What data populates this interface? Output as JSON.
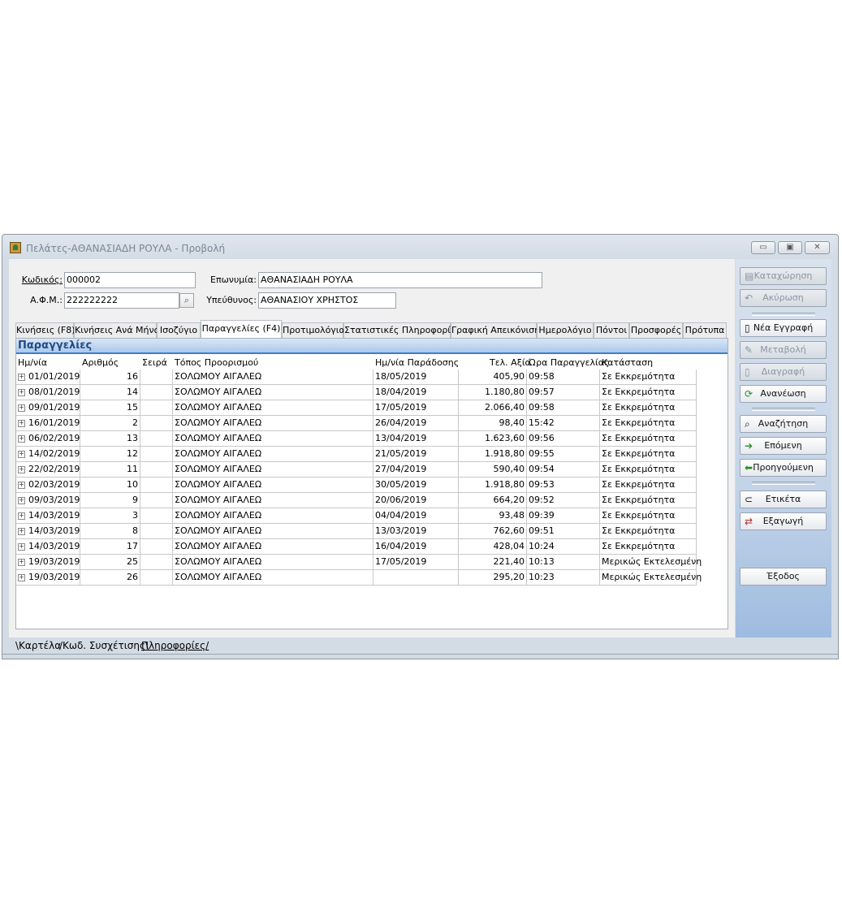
{
  "window": {
    "title": "Πελάτες-ΑΘΑΝΑΣΙΑΔΗ ΡΟΥΛΑ -  Προβολή",
    "controls": {
      "minimize": "▭",
      "maximize": "▣",
      "close": "✕"
    }
  },
  "form": {
    "code_label": "Κωδικός:",
    "code_value": "000002",
    "surname_label": "Επωνυμία:",
    "surname_value": "ΑΘΑΝΑΣΙΑΔΗ ΡΟΥΛΑ",
    "afm_label": "Α.Φ.Μ.:",
    "afm_value": "222222222",
    "responsible_label": "Υπεύθυνος:",
    "responsible_value": "ΑΘΑΝΑΣΙΟΥ ΧΡΗΣΤΟΣ"
  },
  "tabs": [
    "Κινήσεις (F8)",
    "Κινήσεις Ανά Μήνα",
    "Ισοζύγιο",
    "Παραγγελίες (F4)",
    "Προτιμολόγια",
    "Στατιστικές Πληροφορίες",
    "Γραφική Απεικόνιση",
    "Ημερολόγιο",
    "Πόντοι",
    "Προσφορές",
    "Πρότυπα"
  ],
  "active_tab": "Παραγγελίες (F4)",
  "panel": {
    "title": "Παραγγελίες",
    "columns": [
      "Ημ/νία",
      "Αριθμός",
      "Σειρά",
      "Τόπος Προορισμού",
      "Ημ/νία Παράδοσης",
      "Τελ. Αξία",
      "Ώρα Παραγγελίας",
      "Κατάσταση"
    ],
    "rows": [
      [
        "01/01/2019",
        "16",
        "",
        "ΣΟΛΩΜΟΥ ΑΙΓΑΛΕΩ",
        "18/05/2019",
        "405,90",
        "09:58",
        "Σε Εκκρεμότητα"
      ],
      [
        "08/01/2019",
        "14",
        "",
        "ΣΟΛΩΜΟΥ ΑΙΓΑΛΕΩ",
        "18/04/2019",
        "1.180,80",
        "09:57",
        "Σε Εκκρεμότητα"
      ],
      [
        "09/01/2019",
        "15",
        "",
        "ΣΟΛΩΜΟΥ ΑΙΓΑΛΕΩ",
        "17/05/2019",
        "2.066,40",
        "09:58",
        "Σε Εκκρεμότητα"
      ],
      [
        "16/01/2019",
        "2",
        "",
        "ΣΟΛΩΜΟΥ ΑΙΓΑΛΕΩ",
        "26/04/2019",
        "98,40",
        "15:42",
        "Σε Εκκρεμότητα"
      ],
      [
        "06/02/2019",
        "13",
        "",
        "ΣΟΛΩΜΟΥ ΑΙΓΑΛΕΩ",
        "13/04/2019",
        "1.623,60",
        "09:56",
        "Σε Εκκρεμότητα"
      ],
      [
        "14/02/2019",
        "12",
        "",
        "ΣΟΛΩΜΟΥ ΑΙΓΑΛΕΩ",
        "21/05/2019",
        "1.918,80",
        "09:55",
        "Σε Εκκρεμότητα"
      ],
      [
        "22/02/2019",
        "11",
        "",
        "ΣΟΛΩΜΟΥ ΑΙΓΑΛΕΩ",
        "27/04/2019",
        "590,40",
        "09:54",
        "Σε Εκκρεμότητα"
      ],
      [
        "02/03/2019",
        "10",
        "",
        "ΣΟΛΩΜΟΥ ΑΙΓΑΛΕΩ",
        "30/05/2019",
        "1.918,80",
        "09:53",
        "Σε Εκκρεμότητα"
      ],
      [
        "09/03/2019",
        "9",
        "",
        "ΣΟΛΩΜΟΥ ΑΙΓΑΛΕΩ",
        "20/06/2019",
        "664,20",
        "09:52",
        "Σε Εκκρεμότητα"
      ],
      [
        "14/03/2019",
        "3",
        "",
        "ΣΟΛΩΜΟΥ ΑΙΓΑΛΕΩ",
        "04/04/2019",
        "93,48",
        "09:39",
        "Σε Εκκρεμότητα"
      ],
      [
        "14/03/2019",
        "8",
        "",
        "ΣΟΛΩΜΟΥ ΑΙΓΑΛΕΩ",
        "13/03/2019",
        "762,60",
        "09:51",
        "Σε Εκκρεμότητα"
      ],
      [
        "14/03/2019",
        "17",
        "",
        "ΣΟΛΩΜΟΥ ΑΙΓΑΛΕΩ",
        "16/04/2019",
        "428,04",
        "10:24",
        "Σε Εκκρεμότητα"
      ],
      [
        "19/03/2019",
        "25",
        "",
        "ΣΟΛΩΜΟΥ ΑΙΓΑΛΕΩ",
        "17/05/2019",
        "221,40",
        "10:13",
        "Μερικώς Εκτελεσμένη"
      ],
      [
        "19/03/2019",
        "26",
        "",
        "ΣΟΛΩΜΟΥ ΑΙΓΑΛΕΩ",
        "",
        "295,20",
        "10:23",
        "Μερικώς Εκτελεσμένη"
      ]
    ]
  },
  "sidebar": {
    "save": "Καταχώρηση",
    "cancel": "Ακύρωση",
    "new_record": "Νέα Εγγραφή",
    "edit": "Μεταβολή",
    "delete": "Διαγραφή",
    "refresh": "Ανανέωση",
    "search": "Αναζήτηση",
    "next": "Επόμενη",
    "previous": "Προηγούμενη",
    "label": "Ετικέτα",
    "export": "Εξαγωγή",
    "exit": "Έξοδος"
  },
  "bottom_tabs": [
    "Καρτέλα",
    "Κωδ. Συσχέτισης",
    "Πληροφορίες"
  ],
  "colors": {
    "header_accent": "#3c7dd0",
    "sidebar_gradient_end": "#9ebbe0"
  }
}
